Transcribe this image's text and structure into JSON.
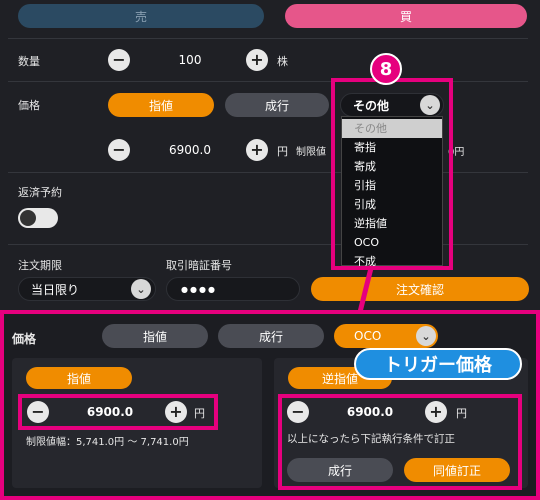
{
  "side": {
    "sell": "売",
    "buy": "買"
  },
  "quantity": {
    "label": "数量",
    "value": "100",
    "unit": "株"
  },
  "price": {
    "label": "価格",
    "limit": "指値",
    "market": "成行",
    "other": "その他",
    "value": "6900.0",
    "unit": "円",
    "limit_range_partial": "制限値",
    "range_tail": "0円"
  },
  "dropdown": {
    "options": [
      "その他",
      "寄指",
      "寄成",
      "引指",
      "引成",
      "逆指値",
      "OCO",
      "不成"
    ]
  },
  "badge": {
    "number": "8"
  },
  "repay": {
    "label": "返済予約"
  },
  "period": {
    "label": "注文期限",
    "value": "当日限り"
  },
  "pin": {
    "label": "取引暗証番号",
    "value": "●●●●"
  },
  "confirm": {
    "label": "注文確認"
  },
  "bottom": {
    "price_label": "価格",
    "limit": "指値",
    "market": "成行",
    "oco": "OCO",
    "trigger_callout": "トリガー価格",
    "left": {
      "tag": "指値",
      "value": "6900.0",
      "unit": "円",
      "range": "制限値幅：5,741.0円 ～ 7,741.0円"
    },
    "right": {
      "tag": "逆指値",
      "value": "6900.0",
      "unit": "円",
      "condition": "以上になったら下記執行条件で訂正",
      "market": "成行",
      "same_price": "同値訂正"
    }
  },
  "colors": {
    "orange": "#f08c00",
    "pink": "#e6568a",
    "navy": "#2b4a62",
    "magenta": "#e6007e",
    "blue_callout": "#1f8fe0"
  }
}
